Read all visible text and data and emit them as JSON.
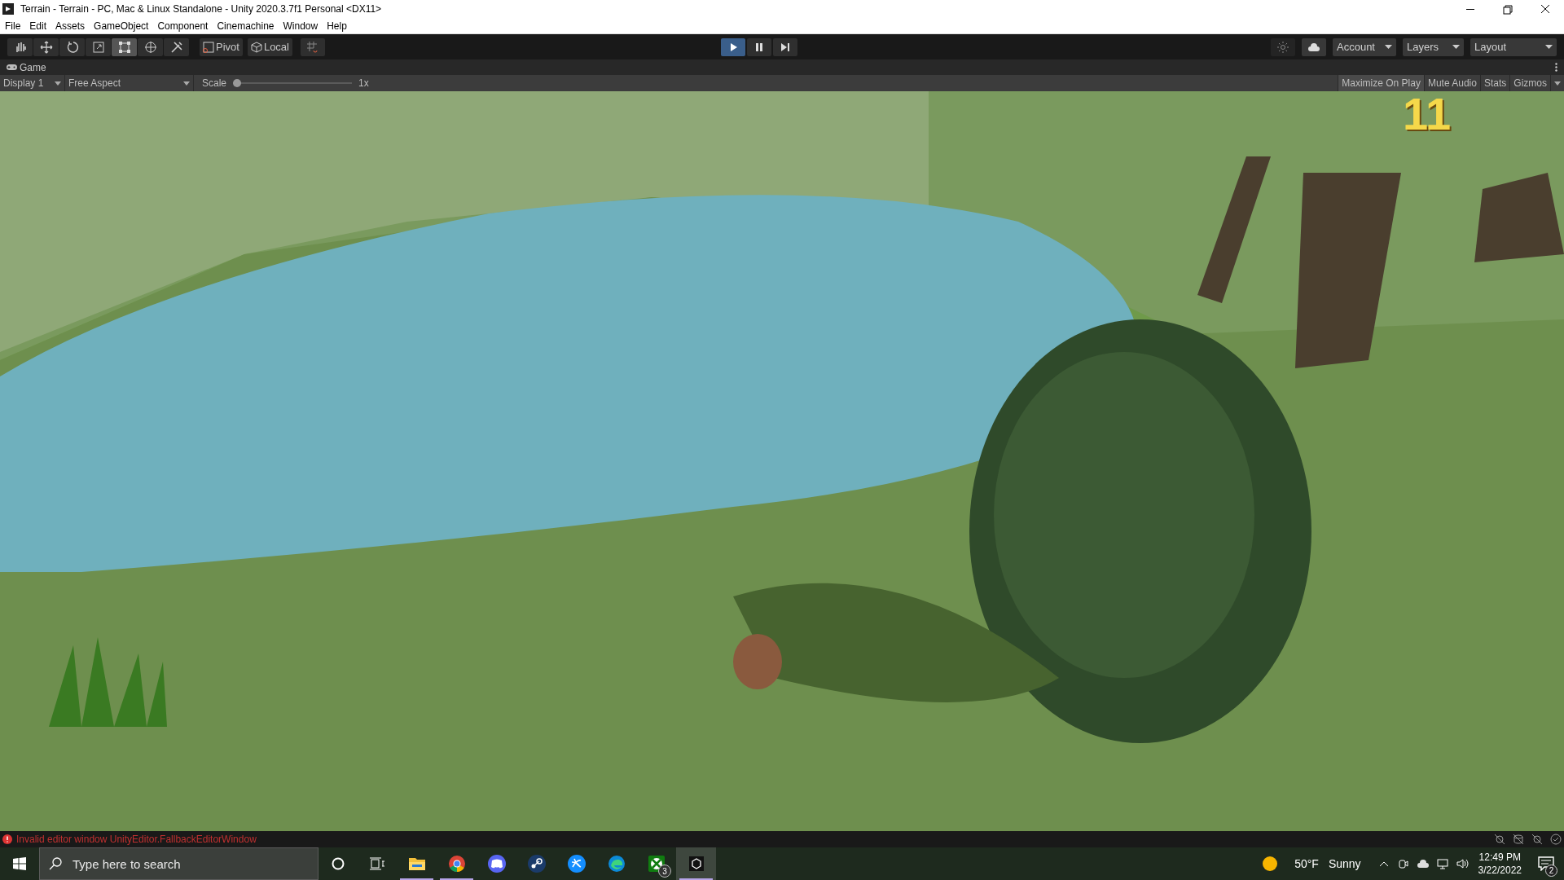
{
  "window": {
    "title": "Terrain - Terrain - PC, Mac & Linux Standalone - Unity 2020.3.7f1 Personal <DX11>"
  },
  "menu": [
    "File",
    "Edit",
    "Assets",
    "GameObject",
    "Component",
    "Cinemachine",
    "Window",
    "Help"
  ],
  "toolbar": {
    "tools": [
      {
        "kind": "hand",
        "selected": false
      },
      {
        "kind": "move",
        "selected": false
      },
      {
        "kind": "rotate",
        "selected": false
      },
      {
        "kind": "scale",
        "selected": false
      },
      {
        "kind": "rect",
        "selected": true
      },
      {
        "kind": "transform",
        "selected": false
      },
      {
        "kind": "custom",
        "selected": false
      }
    ],
    "pivot": "Pivot",
    "handle_space": "Local",
    "playback": [
      {
        "kind": "play",
        "selected": true
      },
      {
        "kind": "pause",
        "selected": false
      },
      {
        "kind": "step",
        "selected": false
      }
    ],
    "dropdowns": [
      "Account",
      "Layers",
      "Layout"
    ]
  },
  "game_tab": {
    "label": "Game"
  },
  "game_toolbar": {
    "display": "Display 1",
    "aspect": "Free Aspect",
    "scale": {
      "label": "Scale",
      "level": 0.0,
      "reading": "1x"
    },
    "toggles": [
      {
        "label": "Maximize On Play",
        "on": true
      },
      {
        "label": "Mute Audio",
        "on": false
      },
      {
        "label": "Stats",
        "on": false
      },
      {
        "label": "Gizmos",
        "on": false
      }
    ]
  },
  "hud": {
    "score": "11"
  },
  "status_bar": {
    "message": "Invalid editor window UnityEditor.FallbackEditorWindow"
  },
  "taskbar": {
    "search": {
      "placeholder": "Type here to search"
    },
    "apps": [
      {
        "kind": "explorer",
        "running": true,
        "active": false
      },
      {
        "kind": "chrome",
        "running": true,
        "active": false
      },
      {
        "kind": "discord",
        "running": false,
        "active": false
      },
      {
        "kind": "steam",
        "running": false,
        "active": false
      },
      {
        "kind": "battlenet",
        "running": false,
        "active": false
      },
      {
        "kind": "edge",
        "running": false,
        "active": false
      },
      {
        "kind": "xbox",
        "running": false,
        "active": false,
        "badge": "3"
      },
      {
        "kind": "unity",
        "running": true,
        "active": true
      }
    ],
    "weather": {
      "temperature": "50°F",
      "condition": "Sunny"
    },
    "clock": {
      "time": "12:49 PM",
      "date": "3/22/2022"
    },
    "notifications": "2"
  }
}
